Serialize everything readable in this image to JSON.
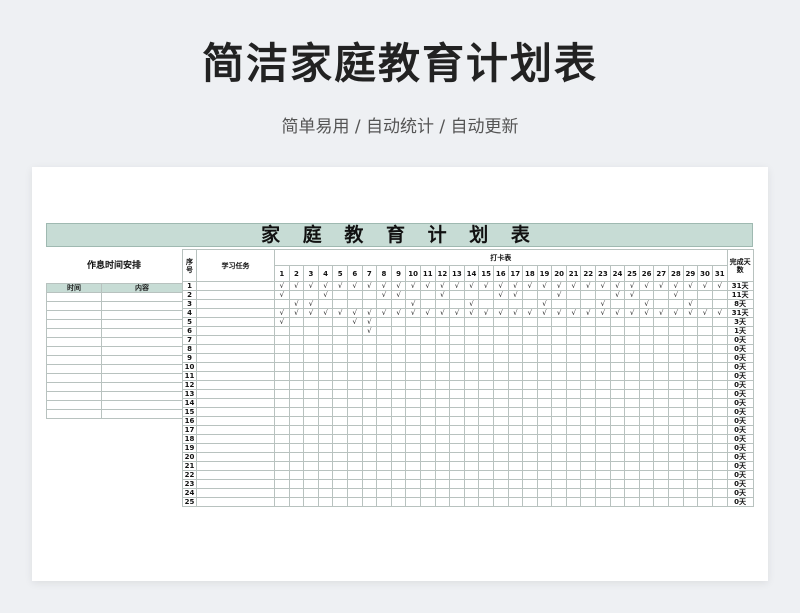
{
  "header": {
    "title": "简洁家庭教育计划表",
    "subtitle": "简单易用 / 自动统计 / 自动更新"
  },
  "sheet": {
    "title": "家 庭 教 育 计 划 表",
    "schedule_title": "作息时间安排",
    "schedule_cols": [
      "时间",
      "内容"
    ],
    "schedule_rows": 14,
    "col_index": "序号",
    "col_task": "学习任务",
    "col_checkin": "打卡表",
    "col_done": "完成天数",
    "check_mark": "√",
    "days": [
      1,
      2,
      3,
      4,
      5,
      6,
      7,
      8,
      9,
      10,
      11,
      12,
      13,
      14,
      15,
      16,
      17,
      18,
      19,
      20,
      21,
      22,
      23,
      24,
      25,
      26,
      27,
      28,
      29,
      30,
      31
    ],
    "rows": [
      {
        "no": "1",
        "checks": [
          1,
          2,
          3,
          4,
          5,
          6,
          7,
          8,
          9,
          10,
          11,
          12,
          13,
          14,
          15,
          16,
          17,
          18,
          19,
          20,
          21,
          22,
          23,
          24,
          25,
          26,
          27,
          28,
          29,
          30,
          31
        ],
        "done": "31天"
      },
      {
        "no": "2",
        "checks": [
          1,
          4,
          8,
          9,
          12,
          16,
          17,
          20,
          24,
          25,
          28
        ],
        "done": "11天"
      },
      {
        "no": "3",
        "checks": [
          2,
          3,
          10,
          14,
          19,
          23,
          26,
          29
        ],
        "done": "8天"
      },
      {
        "no": "4",
        "checks": [
          1,
          2,
          3,
          4,
          5,
          6,
          7,
          8,
          9,
          10,
          11,
          12,
          13,
          14,
          15,
          16,
          17,
          18,
          19,
          20,
          21,
          22,
          23,
          24,
          25,
          26,
          27,
          28,
          29,
          30,
          31
        ],
        "done": "31天"
      },
      {
        "no": "5",
        "checks": [
          1,
          6,
          7
        ],
        "done": "3天"
      },
      {
        "no": "6",
        "checks": [
          7
        ],
        "done": "1天"
      },
      {
        "no": "7",
        "checks": [],
        "done": "0天"
      },
      {
        "no": "8",
        "checks": [],
        "done": "0天"
      },
      {
        "no": "9",
        "checks": [],
        "done": "0天"
      },
      {
        "no": "10",
        "checks": [],
        "done": "0天"
      },
      {
        "no": "11",
        "checks": [],
        "done": "0天"
      },
      {
        "no": "12",
        "checks": [],
        "done": "0天"
      },
      {
        "no": "13",
        "checks": [],
        "done": "0天"
      },
      {
        "no": "14",
        "checks": [],
        "done": "0天"
      },
      {
        "no": "15",
        "checks": [],
        "done": "0天"
      },
      {
        "no": "16",
        "checks": [],
        "done": "0天"
      },
      {
        "no": "17",
        "checks": [],
        "done": "0天"
      },
      {
        "no": "18",
        "checks": [],
        "done": "0天"
      },
      {
        "no": "19",
        "checks": [],
        "done": "0天"
      },
      {
        "no": "20",
        "checks": [],
        "done": "0天"
      },
      {
        "no": "21",
        "checks": [],
        "done": "0天"
      },
      {
        "no": "22",
        "checks": [],
        "done": "0天"
      },
      {
        "no": "23",
        "checks": [],
        "done": "0天"
      },
      {
        "no": "24",
        "checks": [],
        "done": "0天"
      },
      {
        "no": "25",
        "checks": [],
        "done": "0天"
      }
    ]
  },
  "colors": {
    "header_green": "#c7dcd5",
    "grid": "#b8c2bf"
  }
}
